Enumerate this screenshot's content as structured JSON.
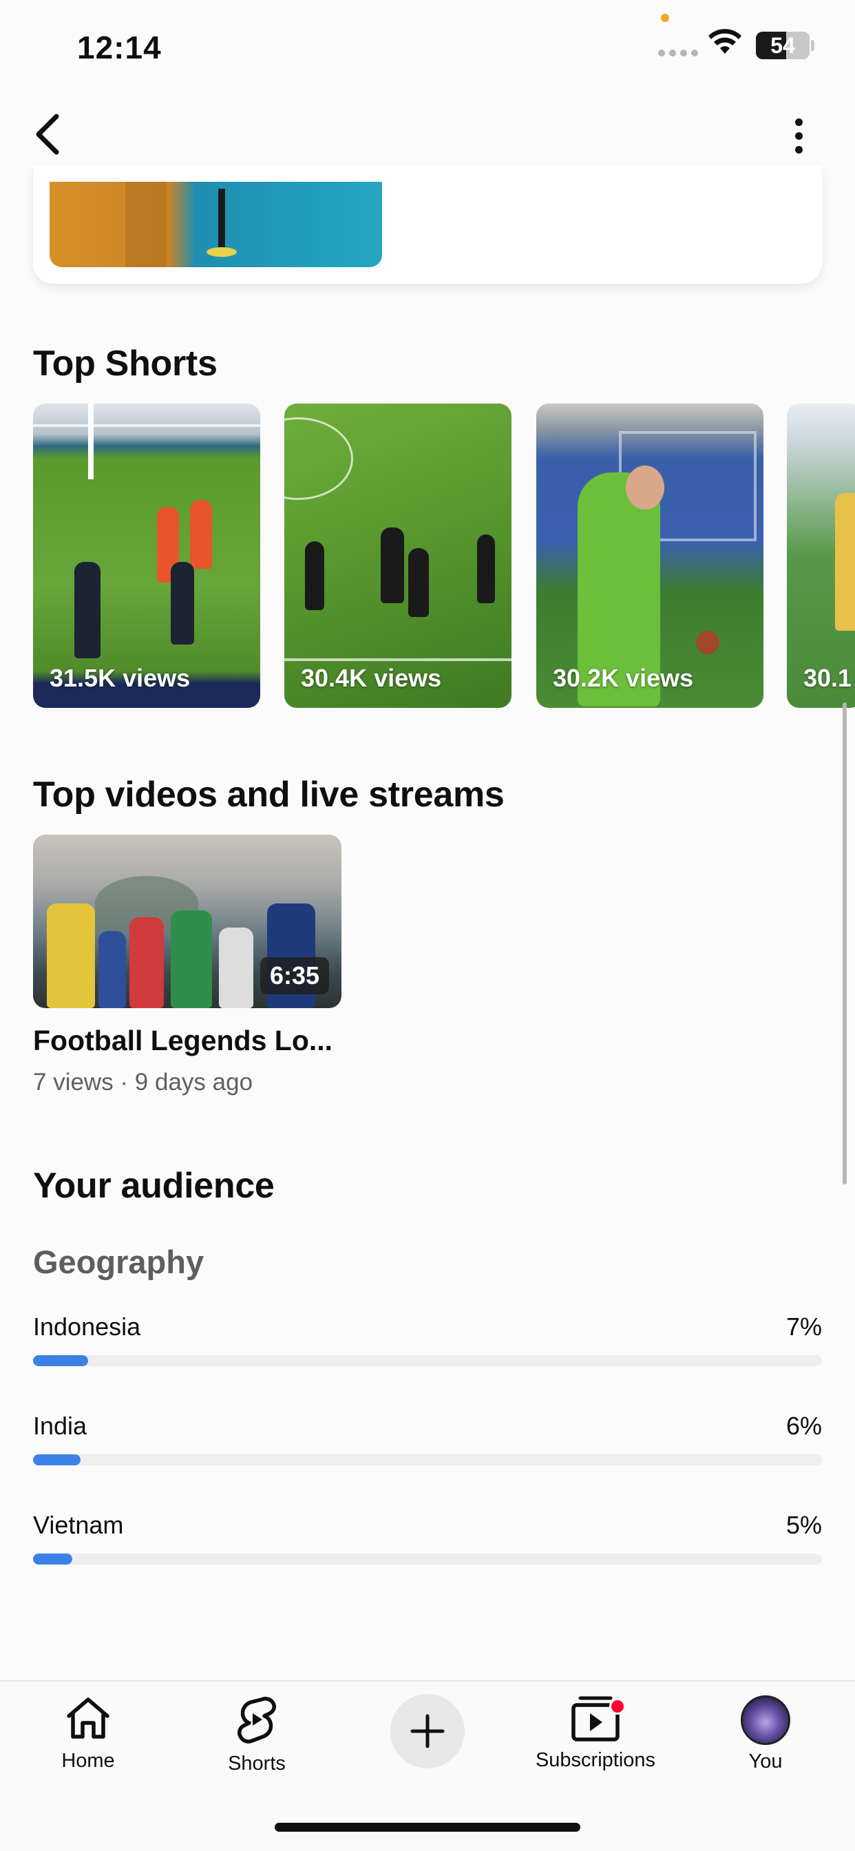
{
  "status_bar": {
    "time": "12:14",
    "battery": "54"
  },
  "top_shorts": {
    "heading": "Top Shorts",
    "items": [
      {
        "views": "31.5K views"
      },
      {
        "views": "30.4K views"
      },
      {
        "views": "30.2K views"
      },
      {
        "views": "30.1"
      }
    ]
  },
  "top_videos": {
    "heading": "Top videos and live streams",
    "items": [
      {
        "title": "Football Legends Lo...",
        "meta": "7 views · 9 days ago",
        "duration": "6:35"
      }
    ]
  },
  "audience": {
    "heading": "Your audience",
    "geography": {
      "heading": "Geography",
      "rows": [
        {
          "country": "Indonesia",
          "percent": "7%",
          "value": 7
        },
        {
          "country": "India",
          "percent": "6%",
          "value": 6
        },
        {
          "country": "Vietnam",
          "percent": "5%",
          "value": 5
        }
      ]
    }
  },
  "bottom_nav": {
    "home": "Home",
    "shorts": "Shorts",
    "subscriptions": "Subscriptions",
    "you": "You"
  },
  "colors": {
    "accent_bar": "#3c82e6",
    "notification_dot": "#ff0033"
  }
}
